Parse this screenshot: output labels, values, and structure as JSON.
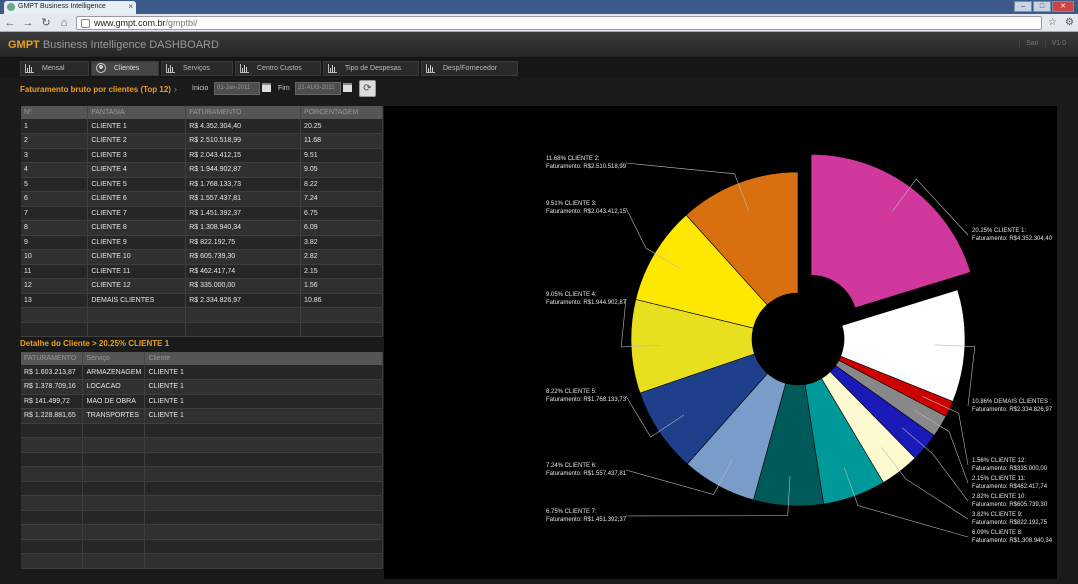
{
  "browser": {
    "tab_title": "GMPT Business Intelligence",
    "url_domain": "www.gmpt.com.br",
    "url_path": "/gmptbi/"
  },
  "header": {
    "brand": "GMPT",
    "title": "Business Intelligence DASHBOARD",
    "logout": "Sair",
    "version": "V1.0"
  },
  "nav": {
    "tabs": [
      "Mensal",
      "Clientes",
      "Serviços",
      "Centro Custos",
      "Tipo de Despesas",
      "Desp/Fornecedor"
    ]
  },
  "filters": {
    "title": "Faturamento bruto por clientes (Top 12)",
    "arrow": "›",
    "start_label": "Inicio",
    "start_value": "01-Jan-2011",
    "end_label": "Fim",
    "end_value": "31-AUG-2011"
  },
  "main_table": {
    "headers": [
      "Nº",
      "FANTASIA",
      "FATURAMENTO",
      "PORCENTAGEM"
    ],
    "rows": [
      [
        "1",
        "CLIENTE 1",
        "R$ 4.352.304,40",
        "20.25"
      ],
      [
        "2",
        "CLIENTE 2",
        "R$ 2.510.518,99",
        "11.68"
      ],
      [
        "3",
        "CLIENTE 3",
        "R$ 2.043.412,15",
        "9.51"
      ],
      [
        "4",
        "CLIENTE 4",
        "R$ 1.944.902,87",
        "9.05"
      ],
      [
        "5",
        "CLIENTE 5",
        "R$ 1.768.133,73",
        "8.22"
      ],
      [
        "6",
        "CLIENTE 6",
        "R$ 1.557.437,81",
        "7.24"
      ],
      [
        "7",
        "CLIENTE 7",
        "R$ 1.451.392,37",
        "6.75"
      ],
      [
        "8",
        "CLIENTE 8",
        "R$ 1.308.940,34",
        "6.09"
      ],
      [
        "9",
        "CLIENTE 9",
        "R$ 822.192,75",
        "3.82"
      ],
      [
        "10",
        "CLIENTE 10",
        "R$ 605.739,30",
        "2.82"
      ],
      [
        "11",
        "CLIENTE 11",
        "R$ 462.417,74",
        "2.15"
      ],
      [
        "12",
        "CLIENTE 12",
        "R$ 335.000,00",
        "1.56"
      ],
      [
        "13",
        "DEMAIS CLIENTES",
        "R$ 2.334.826,97",
        "10.86"
      ]
    ]
  },
  "detail": {
    "title": "Detalhe do Cliente >  20.25% CLIENTE 1",
    "headers": [
      "FATURAMENTO",
      "Serviço",
      "Cliente"
    ],
    "rows": [
      [
        "R$ 1.603.213,87",
        "ARMAZENAGEM",
        "CLIENTE 1"
      ],
      [
        "R$ 1.378.709,16",
        "LOCACAO",
        "CLIENTE 1"
      ],
      [
        "R$ 141.499,72",
        "MAO DE OBRA",
        "CLIENTE 1"
      ],
      [
        "R$ 1.228.881,65",
        "TRANSPORTES",
        "CLIENTE 1"
      ]
    ]
  },
  "chart_data": {
    "type": "pie",
    "variant": "donut, first slice exploded",
    "slices": [
      {
        "name": "CLIENTE 1",
        "pct": 20.25,
        "color": "#d0389e",
        "label_pct": "20.25% CLIENTE 1:",
        "label_val": "Faturamento: R$4.352.304,40"
      },
      {
        "name": "DEMAIS CLIENTES",
        "pct": 10.86,
        "color": "#ffffff",
        "label_pct": "10.86%  DEMAIS CLIENTES :",
        "label_val": "Faturamento: R$2.334.826,97"
      },
      {
        "name": "CLIENTE 12",
        "pct": 1.56,
        "color": "#cc0000",
        "label_pct": "1.56% CLIENTE 12:",
        "label_val": "Faturamento: R$335.000,00"
      },
      {
        "name": "CLIENTE 11",
        "pct": 2.15,
        "color": "#888888",
        "label_pct": "2.15% CLIENTE 11:",
        "label_val": "Faturamento: R$462.417,74"
      },
      {
        "name": "CLIENTE 10",
        "pct": 2.82,
        "color": "#1a1ab8",
        "label_pct": "2.82% CLIENTE 10:",
        "label_val": "Faturamento: R$605.739,30"
      },
      {
        "name": "CLIENTE 9",
        "pct": 3.82,
        "color": "#fffbd0",
        "label_pct": "3.82% CLIENTE 9:",
        "label_val": "Faturamento: R$822.192,75"
      },
      {
        "name": "CLIENTE 8",
        "pct": 6.09,
        "color": "#009999",
        "label_pct": "6.09% CLIENTE 8:",
        "label_val": "Faturamento: R$1.308.940,34"
      },
      {
        "name": "CLIENTE 7",
        "pct": 6.75,
        "color": "#005a5a",
        "label_pct": "6.75% CLIENTE 7:",
        "label_val": "Faturamento: R$1.451.392,37"
      },
      {
        "name": "CLIENTE 6",
        "pct": 7.24,
        "color": "#7a9cc8",
        "label_pct": "7.24% CLIENTE 6:",
        "label_val": "Faturamento: R$1.557.437,81"
      },
      {
        "name": "CLIENTE 5",
        "pct": 8.22,
        "color": "#1e3f8a",
        "label_pct": "8.22% CLIENTE 5:",
        "label_val": "Faturamento: R$1.768.133,73"
      },
      {
        "name": "CLIENTE 4",
        "pct": 9.05,
        "color": "#e8e01e",
        "label_pct": "9.05% CLIENTE 4:",
        "label_val": "Faturamento: R$1.944.902,87"
      },
      {
        "name": "CLIENTE 3",
        "pct": 9.51,
        "color": "#ffe800",
        "label_pct": "9.51% CLIENTE 3:",
        "label_val": "Faturamento: R$2.043.412,15"
      },
      {
        "name": "CLIENTE 2",
        "pct": 11.68,
        "color": "#d87010",
        "label_pct": "11.68% CLIENTE 2:",
        "label_val": "Faturamento: R$2.510.518,99"
      }
    ]
  }
}
